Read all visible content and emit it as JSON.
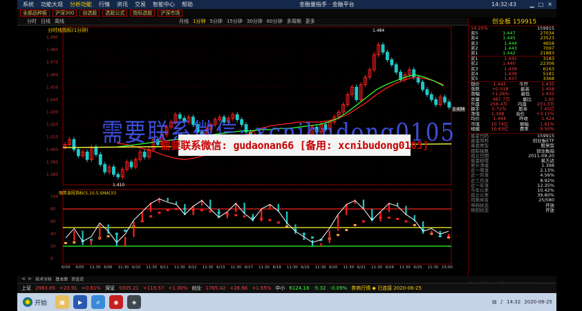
{
  "menu": {
    "items": [
      "系统",
      "功能大观",
      "分析功能",
      "行情",
      "资讯",
      "交易",
      "智能中心",
      "帮助"
    ],
    "app_title": "金融量指手 · 金融平台",
    "clock": "14:32:43"
  },
  "toolbar": {
    "buttons": [
      "全部品种板",
      "沪深300",
      "自选股",
      "选股公式",
      "指标选股",
      "沪深市场"
    ]
  },
  "tabs": [
    "分时",
    "日线",
    "周线",
    "月线",
    "1分钟",
    "5分钟",
    "15分钟",
    "30分钟",
    "60分钟",
    "多周期",
    "更多"
  ],
  "chart": {
    "title": "分时线指标(1分钟)",
    "indicator_title": "强势波段指标(5,10,5,SMA(3))",
    "price_label_high": "1.484",
    "price_label_low": "1.410",
    "latest_price_tag": "1.434",
    "y_ticks": [
      "1.490",
      "1.480",
      "1.470",
      "1.460",
      "1.450",
      "1.440",
      "1.430",
      "1.420",
      "1.410",
      "1.400",
      "1.390",
      "1.380"
    ],
    "sub_y_ticks": [
      "100",
      "80",
      "60",
      "40",
      "20",
      "0"
    ],
    "x_ticks": [
      "6/04",
      "6/05",
      "11:30",
      "6/06",
      "11:30",
      "6/10",
      "11:30",
      "6/11",
      "11:30",
      "6/12",
      "11:30",
      "6/13",
      "11:30",
      "6/17",
      "11:30",
      "6/18",
      "11:30",
      "6/19",
      "11:30",
      "6/20",
      "11:30",
      "6/21",
      "11:30",
      "6/24",
      "11:30",
      "6/25",
      "11:30",
      "15:00"
    ],
    "colors": {
      "up": "#ff2020",
      "down": "#20c8c8",
      "ma_red": "#ff2020",
      "ma_green": "#30ff30",
      "ma_yellow": "#ffff40",
      "k_line": "#ffffff"
    }
  },
  "chart_data": {
    "type": "candlestick",
    "title": "分时线指标(1分钟)",
    "ylim": [
      1.375,
      1.495
    ],
    "candles": [
      1.404,
      1.408,
      1.4,
      1.395,
      1.398,
      1.392,
      1.402,
      1.396,
      1.388,
      1.382,
      1.386,
      1.38,
      1.378,
      1.384,
      1.39,
      1.386,
      1.392,
      1.398,
      1.394,
      1.4,
      1.408,
      1.404,
      1.412,
      1.418,
      1.422,
      1.428,
      1.425,
      1.422,
      1.426,
      1.42,
      1.414,
      1.41,
      1.416,
      1.42,
      1.424,
      1.426,
      1.422,
      1.425,
      1.428,
      1.424,
      1.42,
      1.414,
      1.408,
      1.412,
      1.404,
      1.408,
      1.402,
      1.406,
      1.4,
      1.404,
      1.398,
      1.406,
      1.402,
      1.408,
      1.404,
      1.412,
      1.418,
      1.414,
      1.42,
      1.416,
      1.422,
      1.426,
      1.43,
      1.436,
      1.444,
      1.45,
      1.44,
      1.452,
      1.458,
      1.464,
      1.476,
      1.484,
      1.478,
      1.472,
      1.468,
      1.462,
      1.456,
      1.46,
      1.464,
      1.458,
      1.454,
      1.448,
      1.444,
      1.44,
      1.436,
      1.442,
      1.438,
      1.434
    ],
    "series": [
      {
        "name": "MA20",
        "values": [
          1.405,
          1.404,
          1.402,
          1.4,
          1.398,
          1.395,
          1.393,
          1.392,
          1.393,
          1.395,
          1.398,
          1.402,
          1.406,
          1.41,
          1.414,
          1.417,
          1.419,
          1.42,
          1.421,
          1.422,
          1.422,
          1.422,
          1.423,
          1.425,
          1.428,
          1.433,
          1.438,
          1.444,
          1.449,
          1.453,
          1.456,
          1.458,
          1.457,
          1.455,
          1.452
        ]
      },
      {
        "name": "MA60",
        "values": [
          1.402,
          1.403,
          1.404,
          1.405,
          1.406,
          1.407,
          1.408,
          1.409,
          1.41,
          1.411,
          1.412,
          1.413,
          1.414,
          1.415,
          1.415,
          1.416,
          1.416,
          1.417,
          1.417,
          1.418,
          1.419,
          1.42,
          1.422,
          1.425,
          1.43,
          1.436,
          1.442,
          1.448,
          1.452,
          1.455,
          1.458,
          1.46,
          1.458,
          1.455,
          1.451
        ]
      }
    ],
    "indicator": {
      "overbought": 80,
      "middle": 50,
      "oversold": 20,
      "k": [
        28,
        45,
        22,
        30,
        55,
        40,
        20,
        35,
        60,
        75,
        90,
        98,
        92,
        88,
        70,
        85,
        95,
        80,
        65,
        75,
        90,
        72,
        60,
        80,
        88,
        76,
        55,
        40,
        30,
        20,
        25,
        45,
        70,
        88,
        95,
        80,
        60,
        75,
        90,
        85,
        70,
        60,
        40,
        45,
        35,
        40
      ],
      "d": [
        25,
        26,
        28,
        30,
        33,
        36,
        40,
        45,
        52,
        60,
        68,
        74,
        78,
        80,
        80,
        79,
        78,
        76,
        74,
        72,
        70,
        68,
        66,
        64,
        62,
        58,
        52,
        46,
        40,
        34,
        30,
        32,
        38,
        46,
        54,
        60,
        64,
        66,
        66,
        64,
        60,
        54,
        46,
        40,
        36,
        34
      ]
    }
  },
  "quote": {
    "header": "创业板 159915",
    "sub": "14.25%",
    "sub_code": "159915",
    "sell_label": "卖",
    "buy_label": "买",
    "asks": [
      [
        "5",
        "1.447",
        "27034"
      ],
      [
        "4",
        "1.445",
        "23523"
      ],
      [
        "3",
        "1.444",
        "4658"
      ],
      [
        "2",
        "1.443",
        "7097"
      ],
      [
        "1",
        "1.442",
        "21883"
      ]
    ],
    "bids": [
      [
        "1",
        "1.441",
        "3183"
      ],
      [
        "2",
        "1.440",
        "22306"
      ],
      [
        "3",
        "1.439",
        "6163"
      ],
      [
        "4",
        "1.438",
        "5181"
      ],
      [
        "5",
        "1.437",
        "3368"
      ]
    ],
    "stats": [
      [
        "现价",
        "1.442",
        "今开",
        "1.435"
      ],
      [
        "涨跌",
        "+0.018",
        "最高",
        "1.458"
      ],
      [
        "涨幅",
        "+1.26%",
        "最低",
        "1.435"
      ],
      [
        "总量",
        "487.7万",
        "量比",
        "1.65"
      ],
      [
        "外盘",
        "256.4万",
        "内盘",
        "231.3万"
      ],
      [
        "换手",
        "0.72%",
        "股本",
        "7.45亿"
      ],
      [
        "净值",
        "1.398",
        "溢价",
        "+3.15%"
      ],
      [
        "均价",
        "1.444",
        "昨收",
        "1.424"
      ],
      [
        "市值",
        "10.74亿",
        "振幅",
        "1.61%"
      ],
      [
        "规模",
        "10.63亿",
        "费率",
        "0.50%"
      ]
    ],
    "fund_rows": [
      [
        "基金代码",
        "159915"
      ],
      [
        "基金简称",
        "创业板ETF"
      ],
      [
        "基金类型",
        "股票型"
      ],
      [
        "跟踪指数",
        "创业板指"
      ],
      [
        "成立日期",
        "2011-09-20"
      ],
      [
        "基金经理",
        "易方达"
      ],
      [
        "累计净值",
        "1.398"
      ],
      [
        "近一周涨",
        "2.13%"
      ],
      [
        "近一月涨",
        "4.56%"
      ],
      [
        "近三月涨",
        "8.92%"
      ],
      [
        "近一年涨",
        "12.35%"
      ],
      [
        "今年以来",
        "10.42%"
      ],
      [
        "成立以来",
        "39.80%"
      ],
      [
        "同类排名",
        "25/580"
      ],
      [
        "申购状态",
        "开放"
      ],
      [
        "赎回状态",
        "开放"
      ]
    ],
    "tabs": [
      "盘口",
      "分时",
      "成交",
      "财务"
    ]
  },
  "scroll_tabs": [
    "⊲",
    "⊳",
    "技术分析",
    "基本面",
    "资金流"
  ],
  "status": {
    "items": [
      {
        "label": "上证",
        "value": "2983.85",
        "change": "+23.91",
        "pct": "+0.81%",
        "color": "#ff3c3c"
      },
      {
        "label": "深证",
        "value": "9305.21",
        "change": "+119.57",
        "pct": "+1.30%",
        "color": "#ff3c3c"
      },
      {
        "label": "创业",
        "value": "1765.42",
        "change": "+28.66",
        "pct": "+1.65%",
        "color": "#ff3c3c"
      },
      {
        "label": "中小",
        "value": "6124.18",
        "change": "-5.32",
        "pct": "-0.09%",
        "color": "#3cff3c"
      }
    ],
    "message": "券商行情 ◆ 已连接 2020-06-25"
  },
  "taskbar": {
    "start_label": "开始",
    "tray_time": "14:32",
    "tray_date": "2020-06-25"
  },
  "watermark": {
    "main": "需要联系微信: gudaonan66 [备用: xcnibudong0105]",
    "ghost": "需要联系微信: xcnibudong0105"
  }
}
